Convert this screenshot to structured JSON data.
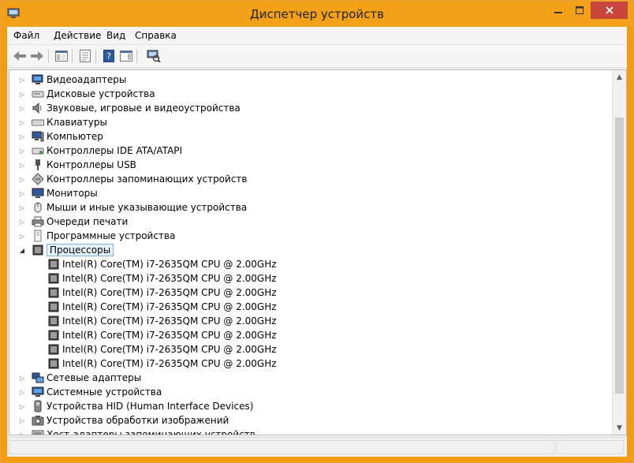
{
  "window": {
    "title": "Диспетчер устройств"
  },
  "menu": [
    "Файл",
    "Действие",
    "Вид",
    "Справка"
  ],
  "tree": {
    "items": [
      {
        "label": "Видеоадаптеры",
        "icon": "display-adapter-icon",
        "expanded": false
      },
      {
        "label": "Дисковые устройства",
        "icon": "disk-drive-icon",
        "expanded": false
      },
      {
        "label": "Звуковые, игровые и видеоустройства",
        "icon": "speaker-icon",
        "expanded": false
      },
      {
        "label": "Клавиатуры",
        "icon": "keyboard-icon",
        "expanded": false
      },
      {
        "label": "Компьютер",
        "icon": "computer-icon",
        "expanded": false
      },
      {
        "label": "Контроллеры IDE ATA/ATAPI",
        "icon": "ide-controller-icon",
        "expanded": false
      },
      {
        "label": "Контроллеры USB",
        "icon": "usb-icon",
        "expanded": false
      },
      {
        "label": "Контроллеры запоминающих устройств",
        "icon": "storage-controller-icon",
        "expanded": false
      },
      {
        "label": "Мониторы",
        "icon": "monitor-icon",
        "expanded": false
      },
      {
        "label": "Мыши и иные указывающие устройства",
        "icon": "mouse-icon",
        "expanded": false
      },
      {
        "label": "Очереди печати",
        "icon": "printer-icon",
        "expanded": false
      },
      {
        "label": "Программные устройства",
        "icon": "software-device-icon",
        "expanded": false
      },
      {
        "label": "Процессоры",
        "icon": "processor-icon",
        "expanded": true,
        "selected": true
      },
      {
        "label": "Сетевые адаптеры",
        "icon": "network-adapter-icon",
        "expanded": false
      },
      {
        "label": "Системные устройства",
        "icon": "system-device-icon",
        "expanded": false
      },
      {
        "label": "Устройства HID (Human Interface Devices)",
        "icon": "hid-icon",
        "expanded": false
      },
      {
        "label": "Устройства обработки изображений",
        "icon": "camera-icon",
        "expanded": false
      },
      {
        "label": "Хост-адаптеры запоминающих устройств",
        "icon": "storage-host-icon",
        "expanded": false
      }
    ],
    "processors": [
      "Intel(R) Core(TM) i7-2635QM CPU @ 2.00GHz",
      "Intel(R) Core(TM) i7-2635QM CPU @ 2.00GHz",
      "Intel(R) Core(TM) i7-2635QM CPU @ 2.00GHz",
      "Intel(R) Core(TM) i7-2635QM CPU @ 2.00GHz",
      "Intel(R) Core(TM) i7-2635QM CPU @ 2.00GHz",
      "Intel(R) Core(TM) i7-2635QM CPU @ 2.00GHz",
      "Intel(R) Core(TM) i7-2635QM CPU @ 2.00GHz",
      "Intel(R) Core(TM) i7-2635QM CPU @ 2.00GHz"
    ]
  },
  "colors": {
    "titlebar": "#f4a11a",
    "close": "#c7453a",
    "selection": "#e5f1fb"
  }
}
